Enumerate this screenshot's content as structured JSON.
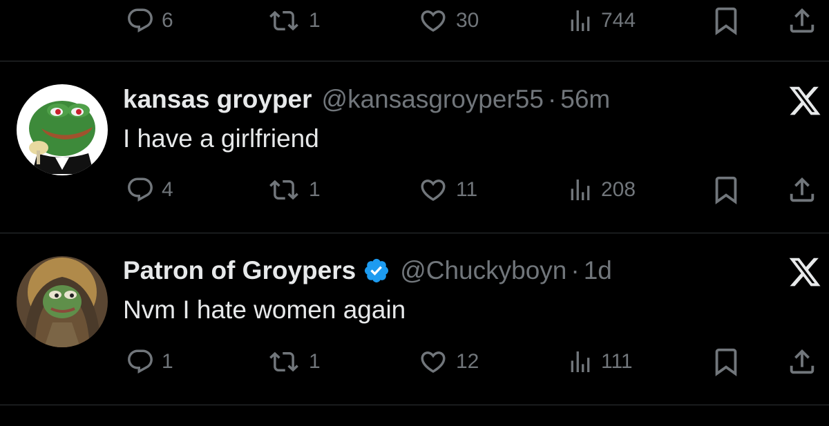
{
  "colors": {
    "background": "#000000",
    "primary_text": "#e7e9ea",
    "secondary_text": "#71767b",
    "divider": "#2f3336",
    "verified_blue": "#1d9bf0"
  },
  "top_tweet_actions": {
    "replies": "6",
    "reposts": "1",
    "likes": "30",
    "views": "744"
  },
  "tweets": [
    {
      "display_name": "kansas groyper",
      "handle": "@kansasgroyper55",
      "separator": "·",
      "time": "56m",
      "verified": false,
      "text": "I have a girlfriend",
      "avatar_icon": "pepe-tuxedo-avatar",
      "actions": {
        "replies": "4",
        "reposts": "1",
        "likes": "11",
        "views": "208"
      }
    },
    {
      "display_name": "Patron of Groypers",
      "handle": "@Chuckyboyn",
      "separator": "·",
      "time": "1d",
      "verified": true,
      "text": "Nvm I hate women again",
      "avatar_icon": "pepe-icon-painting-avatar",
      "actions": {
        "replies": "1",
        "reposts": "1",
        "likes": "12",
        "views": "111"
      }
    }
  ]
}
